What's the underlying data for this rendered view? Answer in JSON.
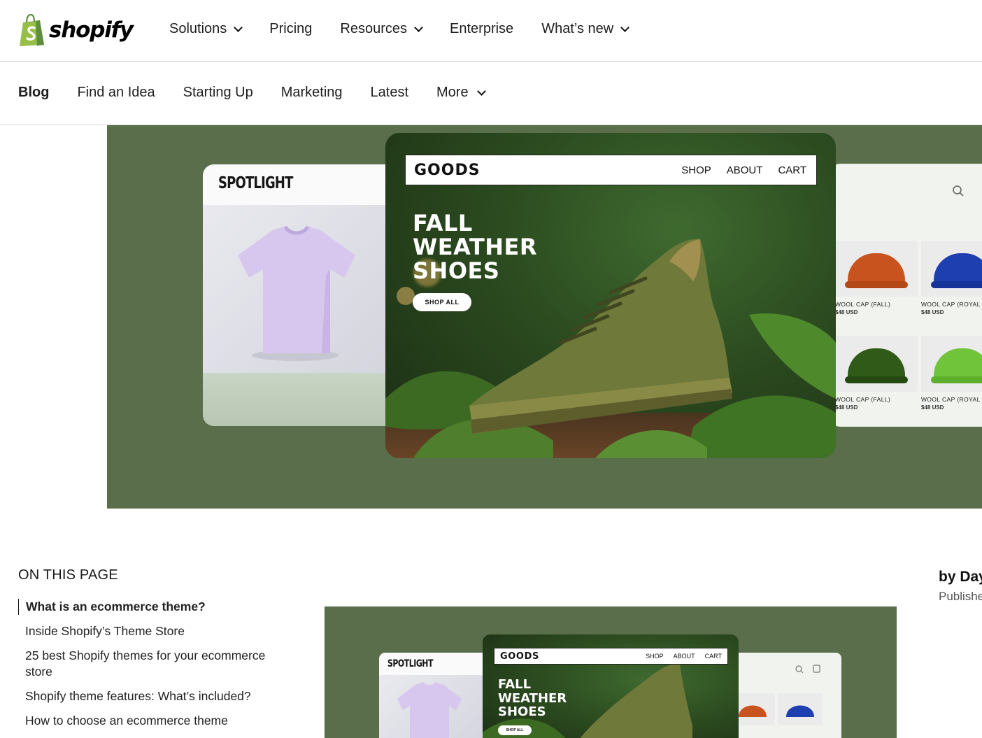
{
  "topnav": {
    "brand": "shopify",
    "items": [
      {
        "label": "Solutions",
        "has_dropdown": true
      },
      {
        "label": "Pricing",
        "has_dropdown": false
      },
      {
        "label": "Resources",
        "has_dropdown": true
      },
      {
        "label": "Enterprise",
        "has_dropdown": false
      },
      {
        "label": "What’s new",
        "has_dropdown": true
      }
    ]
  },
  "blognav": {
    "items": [
      {
        "label": "Blog",
        "has_dropdown": false
      },
      {
        "label": "Find an Idea",
        "has_dropdown": false
      },
      {
        "label": "Starting Up",
        "has_dropdown": false
      },
      {
        "label": "Marketing",
        "has_dropdown": false
      },
      {
        "label": "Latest",
        "has_dropdown": false
      },
      {
        "label": "More",
        "has_dropdown": true
      }
    ]
  },
  "hero": {
    "spotlight_title": "SPOTLIGHT",
    "goods": {
      "brand": "GOODS",
      "links": [
        "SHOP",
        "ABOUT",
        "CART"
      ],
      "headline": [
        "FALL",
        "WEATHER",
        "SHOES"
      ],
      "button": "SHOP ALL"
    },
    "products": [
      {
        "name": "WOOL CAP (FALL)",
        "price": "$48 USD",
        "color": "#c9531f"
      },
      {
        "name": "WOOL CAP (ROYAL",
        "price": "$48 USD",
        "color": "#1d3fb0"
      },
      {
        "name": "WOOL CAP (FALL)",
        "price": "$48 USD",
        "color": "#2f5a17"
      },
      {
        "name": "WOOL CAP (ROYAL",
        "price": "$48 USD",
        "color": "#6fc43a"
      }
    ],
    "background": "#5a6e4c"
  },
  "toc": {
    "title": "ON THIS PAGE",
    "items": [
      "What is an ecommerce theme?",
      "Inside Shopify’s Theme Store",
      "25 best Shopify themes for your ecommerce store",
      "Shopify theme features: What’s included?",
      "How to choose an ecommerce theme"
    ],
    "active_index": 0
  },
  "byline": {
    "author": "by Day",
    "published": "Publishe"
  },
  "thumbnail": {
    "spotlight_title": "SPOTLIGHT",
    "brand": "GOODS",
    "links": [
      "SHOP",
      "ABOUT",
      "CART"
    ],
    "headline": [
      "FALL",
      "WEATHER",
      "SHOES"
    ],
    "button": "SHOP ALL"
  },
  "colors": {
    "brand_green": "#95bf47",
    "brand_green_dark": "#5e8e3e",
    "hero_bg": "#5a6e4c"
  }
}
